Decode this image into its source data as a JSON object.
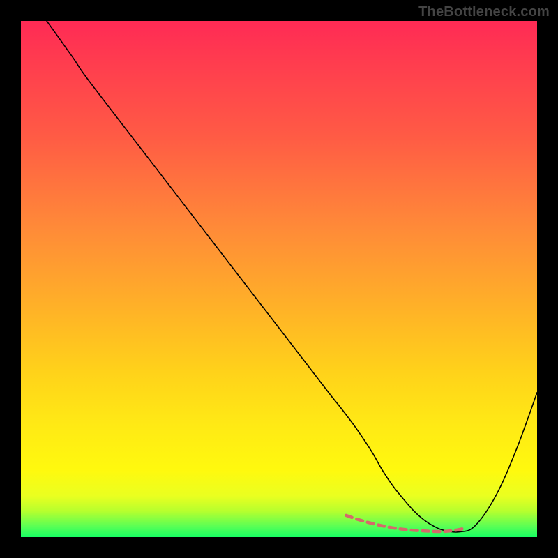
{
  "watermark": "TheBottleneck.com",
  "chart_data": {
    "type": "line",
    "title": "",
    "xlabel": "",
    "ylabel": "",
    "xlim": [
      0,
      100
    ],
    "ylim": [
      0,
      100
    ],
    "series": [
      {
        "name": "black-curve",
        "color": "#000000",
        "width": 1.6,
        "x": [
          5,
          10,
          12,
          15,
          20,
          25,
          30,
          35,
          40,
          45,
          50,
          55,
          60,
          62,
          65,
          68,
          70,
          72,
          74,
          76,
          78,
          80,
          82,
          85,
          88,
          92,
          96,
          100
        ],
        "y": [
          100,
          93,
          90,
          86,
          79.5,
          73,
          66.5,
          60,
          53.5,
          47,
          40.5,
          34,
          27.5,
          25,
          21,
          16.5,
          13,
          10,
          7.5,
          5.2,
          3.4,
          2.1,
          1.3,
          1.0,
          2.2,
          8,
          17,
          28
        ]
      },
      {
        "name": "red-dash",
        "color": "#d46a6a",
        "width": 4.5,
        "dash": "9 7",
        "x": [
          63,
          66,
          69,
          72,
          75,
          78,
          80,
          82,
          84,
          86
        ],
        "y": [
          4.2,
          3.2,
          2.4,
          1.8,
          1.4,
          1.2,
          1.1,
          1.1,
          1.3,
          1.7
        ]
      }
    ]
  }
}
